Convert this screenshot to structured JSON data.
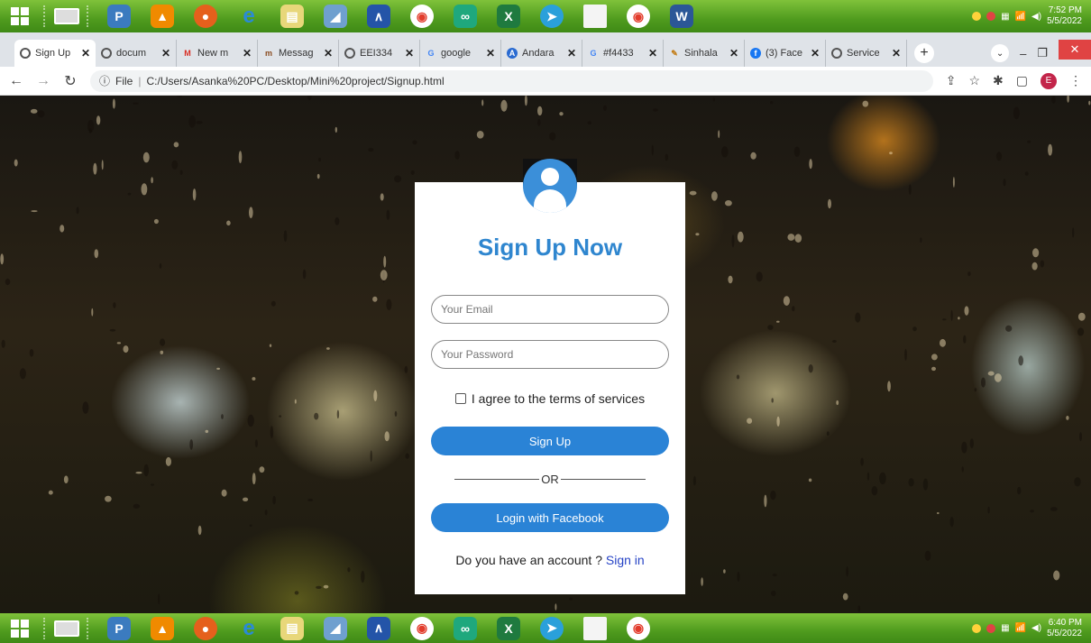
{
  "taskbar_top": {
    "time": "7:52 PM",
    "date": "5/5/2022"
  },
  "taskbar_bottom": {
    "time": "6:40 PM",
    "date": "5/5/2022"
  },
  "tabs": [
    {
      "label": "Sign Up",
      "active": true
    },
    {
      "label": "docum",
      "active": false
    },
    {
      "label": "New m",
      "active": false
    },
    {
      "label": "Messag",
      "active": false
    },
    {
      "label": "EEI334",
      "active": false
    },
    {
      "label": "google",
      "active": false
    },
    {
      "label": "Andara",
      "active": false
    },
    {
      "label": "#f4433",
      "active": false
    },
    {
      "label": "Sinhala",
      "active": false
    },
    {
      "label": "(3) Face",
      "active": false
    },
    {
      "label": "Service",
      "active": false
    }
  ],
  "address": {
    "scheme_label": "File",
    "url": "C:/Users/Asanka%20PC/Desktop/Mini%20project/Signup.html"
  },
  "profile_initial": "E",
  "form": {
    "title": "Sign Up Now",
    "email_placeholder": "Your Email",
    "password_placeholder": "Your Password",
    "agree_text": "I agree to the terms of services",
    "signup_label": "Sign Up",
    "or_text": "OR",
    "facebook_label": "Login with Facebook",
    "account_text": "Do you have an account ?",
    "signin_label": "Sign in"
  },
  "colors": {
    "accent": "#2a83d6",
    "title": "#2f86cf",
    "link": "#2744c6"
  }
}
